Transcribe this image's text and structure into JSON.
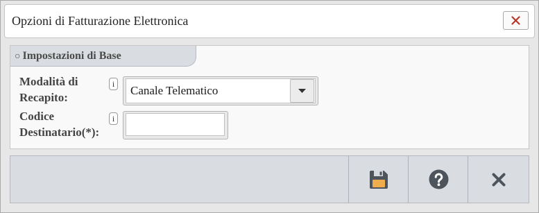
{
  "dialog": {
    "title": "Opzioni di Fatturazione Elettronica",
    "close_icon": "close-icon"
  },
  "section": {
    "bullet": "○",
    "title": "Impostazioni di Base"
  },
  "form": {
    "delivery_mode": {
      "label": "Modalità di Recapito:",
      "info_glyph": "i",
      "info_icon": "info-icon",
      "value": "Canale Telematico",
      "dropdown_icon": "chevron-down-icon"
    },
    "recipient_code": {
      "label": "Codice Destinatario(*):",
      "info_glyph": "i",
      "info_icon": "info-icon",
      "value": ""
    }
  },
  "toolbar": {
    "buttons": [
      {
        "icon": "save-icon"
      },
      {
        "icon": "help-icon"
      },
      {
        "icon": "close-icon"
      }
    ]
  },
  "colors": {
    "panel_header": "#d9dce1",
    "toolbar_icon": "#4d545c",
    "close_accent": "#b5362b",
    "save_label": "#f0ad4e"
  }
}
